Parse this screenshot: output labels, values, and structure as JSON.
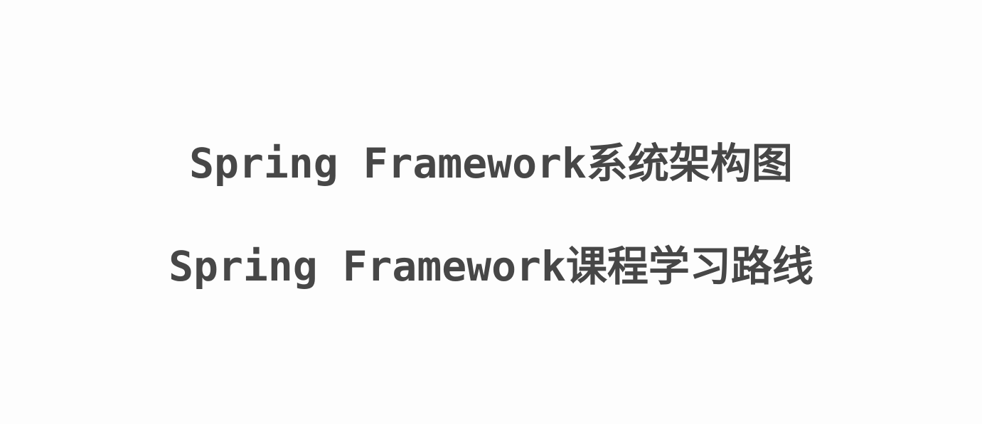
{
  "slide": {
    "lines": [
      "Spring Framework系统架构图",
      "Spring Framework课程学习路线"
    ]
  }
}
